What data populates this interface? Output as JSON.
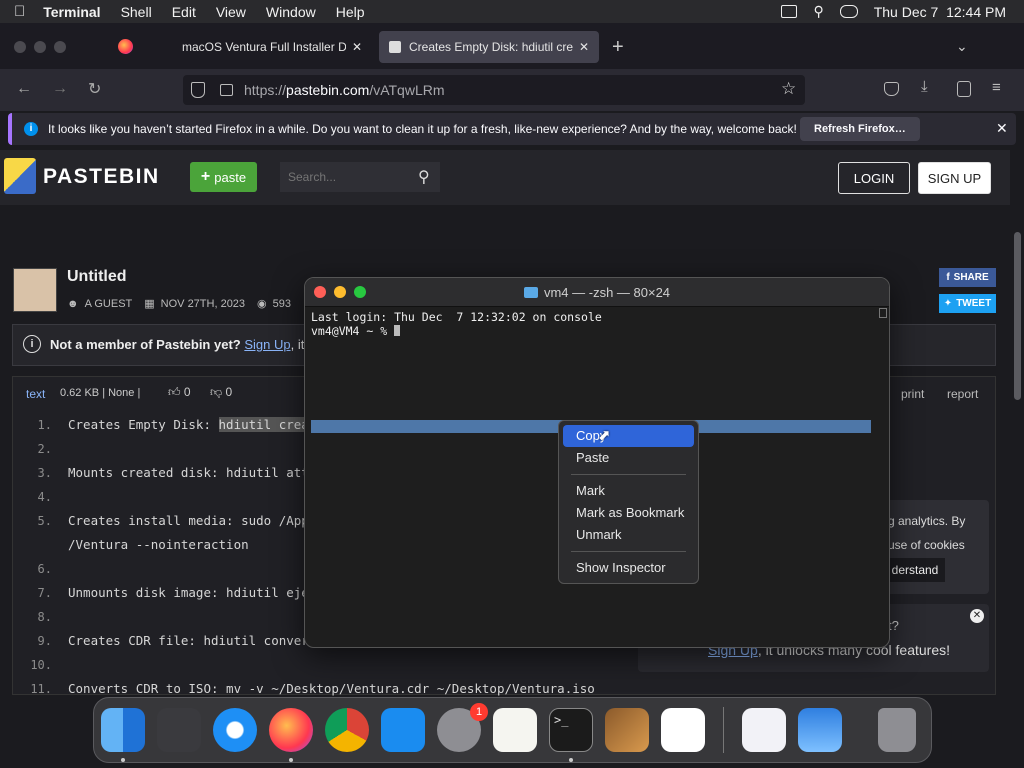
{
  "menubar": {
    "app": "Terminal",
    "items": [
      "Shell",
      "Edit",
      "View",
      "Window",
      "Help"
    ],
    "datetime": "Thu Dec 7  12:44 PM"
  },
  "browser": {
    "tabs": [
      {
        "label": "macOS Ventura Full Installer Da"
      },
      {
        "label": "Creates Empty Disk: hdiutil crea"
      }
    ],
    "url_prefix": "https://",
    "url_domain": "pastebin.com",
    "url_path": "/vATqwLRm",
    "notification": "It looks like you haven’t started Firefox in a while. Do you want to clean it up for a fresh, like-new experience? And by the way, welcome back!",
    "notification_button": "Refresh Firefox…"
  },
  "pastebin": {
    "logo": "PASTEBIN",
    "paste_button": "paste",
    "search_placeholder": "Search...",
    "login": "LOGIN",
    "signup": "SIGN UP",
    "title": "Untitled",
    "author": "A GUEST",
    "date": "NOV 27TH, 2023",
    "views": "593",
    "share": "SHARE",
    "tweet": "TWEET",
    "member_notice": "Not a member of Pastebin yet?",
    "member_link": "Sign Up",
    "member_suffix": ", it",
    "syntax": "text",
    "size": "0.62 KB | None |",
    "likes": "0",
    "dislikes": "0",
    "print": "print",
    "report": "report",
    "cookie_text1": "g analytics. By",
    "cookie_text2": "use of cookies",
    "cookie_btn": "derstand",
    "promo_text": "t?",
    "promo_link": "Sign Up",
    "promo_suffix": ", it unlocks many cool features!",
    "code_lines": [
      {
        "n": "1.",
        "t": "Creates Empty Disk: ",
        "h": "hdiutil creat"
      },
      {
        "n": "2.",
        "t": ""
      },
      {
        "n": "3.",
        "t": "Mounts created disk: hdiutil atta"
      },
      {
        "n": "4.",
        "t": ""
      },
      {
        "n": "5.",
        "t": "Creates install media: sudo /Appl"
      },
      {
        "n": "",
        "t": "/Ventura --nointeraction"
      },
      {
        "n": "6.",
        "t": ""
      },
      {
        "n": "7.",
        "t": "Unmounts disk image: hdiutil ejec"
      },
      {
        "n": "8.",
        "t": ""
      },
      {
        "n": "9.",
        "t": "Creates CDR file: hdiutil convert"
      },
      {
        "n": "10.",
        "t": ""
      },
      {
        "n": "11.",
        "t": "Converts CDR to ISO: mv -v ~/Desktop/Ventura.cdr ~/Desktop/Ventura.iso"
      }
    ]
  },
  "terminal": {
    "title": "vm4 — -zsh — 80×24",
    "line1": "Last login: Thu Dec  7 12:32:02 on console",
    "line2": "vm4@VM4 ~ % "
  },
  "context_menu": {
    "items": [
      "Copy",
      "Paste",
      "Mark",
      "Mark as Bookmark",
      "Unmark",
      "Show Inspector"
    ]
  },
  "dock": {
    "badge": "1"
  }
}
